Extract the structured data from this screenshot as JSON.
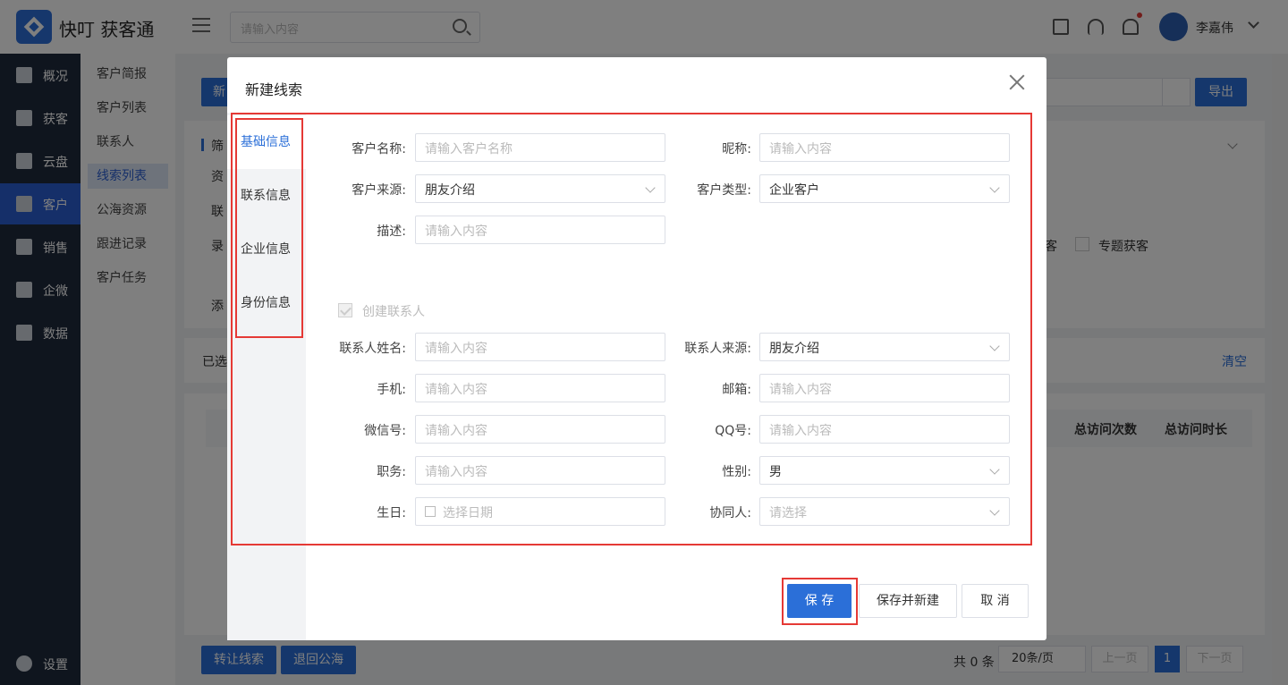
{
  "app": {
    "name": "快叮 获客通",
    "search_placeholder": "请输入内容",
    "user_name": "李嘉伟"
  },
  "sidebar": [
    {
      "label": "概况"
    },
    {
      "label": "获客"
    },
    {
      "label": "云盘"
    },
    {
      "label": "客户"
    },
    {
      "label": "销售"
    },
    {
      "label": "企微"
    },
    {
      "label": "数据"
    },
    {
      "label": "设置"
    }
  ],
  "submenu": [
    {
      "label": "客户简报"
    },
    {
      "label": "客户列表"
    },
    {
      "label": "联系人"
    },
    {
      "label": "线索列表"
    },
    {
      "label": "公海资源"
    },
    {
      "label": "跟进记录"
    },
    {
      "label": "客户任务"
    }
  ],
  "background": {
    "new_btn": "新",
    "export_btn": "导出",
    "filter_title": "筛",
    "row_labels": [
      "资",
      "联",
      "录",
      "添"
    ],
    "selected_prefix": "已选",
    "clear_link": "清空",
    "checkbox_label": "专题获客",
    "chk_partial": "客",
    "col_visits": "总访问次数",
    "col_duration": "总访问时长",
    "transfer_btn": "转让线索",
    "return_btn": "退回公海",
    "total": "共 0 条",
    "page_size": "20条/页",
    "prev": "上一页",
    "page": "1",
    "next": "下一页"
  },
  "modal": {
    "title": "新建线索",
    "tabs": [
      {
        "label": "基础信息"
      },
      {
        "label": "联系信息"
      },
      {
        "label": "企业信息"
      },
      {
        "label": "身份信息"
      }
    ],
    "basic": {
      "customer_name_label": "客户名称:",
      "customer_name_placeholder": "请输入客户名称",
      "nickname_label": "昵称:",
      "nickname_placeholder": "请输入内容",
      "source_label": "客户来源:",
      "source_value": "朋友介绍",
      "type_label": "客户类型:",
      "type_value": "企业客户",
      "desc_label": "描述:",
      "desc_placeholder": "请输入内容"
    },
    "create_contact_label": "创建联系人",
    "contact": {
      "name_label": "联系人姓名:",
      "name_placeholder": "请输入内容",
      "source_label": "联系人来源:",
      "source_value": "朋友介绍",
      "phone_label": "手机:",
      "phone_placeholder": "请输入内容",
      "email_label": "邮箱:",
      "email_placeholder": "请输入内容",
      "wechat_label": "微信号:",
      "wechat_placeholder": "请输入内容",
      "qq_label": "QQ号:",
      "qq_placeholder": "请输入内容",
      "job_label": "职务:",
      "job_placeholder": "请输入内容",
      "gender_label": "性别:",
      "gender_value": "男",
      "birthday_label": "生日:",
      "birthday_placeholder": "选择日期",
      "collab_label": "协同人:",
      "collab_placeholder": "请选择"
    },
    "buttons": {
      "save": "保 存",
      "save_new": "保存并新建",
      "cancel": "取 消"
    }
  }
}
